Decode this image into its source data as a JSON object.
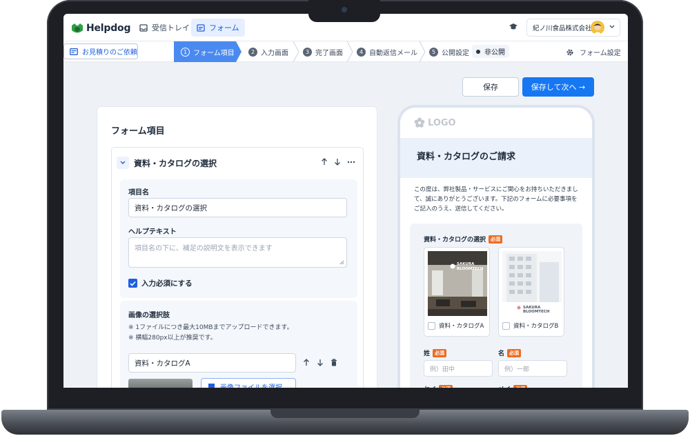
{
  "app": {
    "logo_text": "Helpdog",
    "nav": [
      {
        "label": "受信トレイ"
      },
      {
        "label": "フォーム"
      }
    ],
    "company": "紀ノ川食品株式会社"
  },
  "subnav": {
    "estimate_label": "お見積りのご依頼",
    "steps": [
      {
        "num": "1",
        "label": "フォーム項目"
      },
      {
        "num": "2",
        "label": "入力画面"
      },
      {
        "num": "3",
        "label": "完了画面"
      },
      {
        "num": "4",
        "label": "自動返信メール"
      },
      {
        "num": "5",
        "label": "公開設定"
      }
    ],
    "status": "非公開",
    "settings_label": "フォーム設定"
  },
  "actions": {
    "save": "保存",
    "save_next": "保存して次へ →"
  },
  "editor": {
    "title": "フォーム項目",
    "field": {
      "title": "資料・カタログの選択",
      "name_label": "項目名",
      "name_value": "資料・カタログの選択",
      "help_label": "ヘルプテキスト",
      "help_placeholder": "項目名の下に、補足の説明文を表示できます",
      "required_label": "入力必須にする",
      "required_checked": true
    },
    "image_options": {
      "title": "画像の選択肢",
      "note1": "※ 1ファイルにつき最大10MBまでアップロードできます。",
      "note2": "※ 横幅280px以上が推奨です。",
      "option1_value": "資料・カタログA",
      "upload_label": "画像ファイルを選択"
    }
  },
  "preview": {
    "logo": "LOGO",
    "title": "資料・カタログのご請求",
    "description": "この度は、弊社製品・サービスにご関心をお持ちいただきまして、誠にありがとうございます。下記のフォームに必要事項をご記入のうえ、送信してください。",
    "field_label": "資料・カタログの選択",
    "required_badge": "必須",
    "options": [
      {
        "label": "資料・カタログA"
      },
      {
        "label": "資料・カタログB"
      }
    ],
    "img_brand": "SAKURA BLOOMTECH",
    "last_name_label": "姓",
    "last_name_placeholder": "例）田中",
    "first_name_label": "名",
    "first_name_placeholder": "例）一郎",
    "last_kana_label": "セイ",
    "first_kana_label": "メイ"
  },
  "colors": {
    "accent": "#1677f2",
    "step_active": "#4a8af0",
    "required": "#f06b1f",
    "brand_green": "#2f9e44"
  }
}
